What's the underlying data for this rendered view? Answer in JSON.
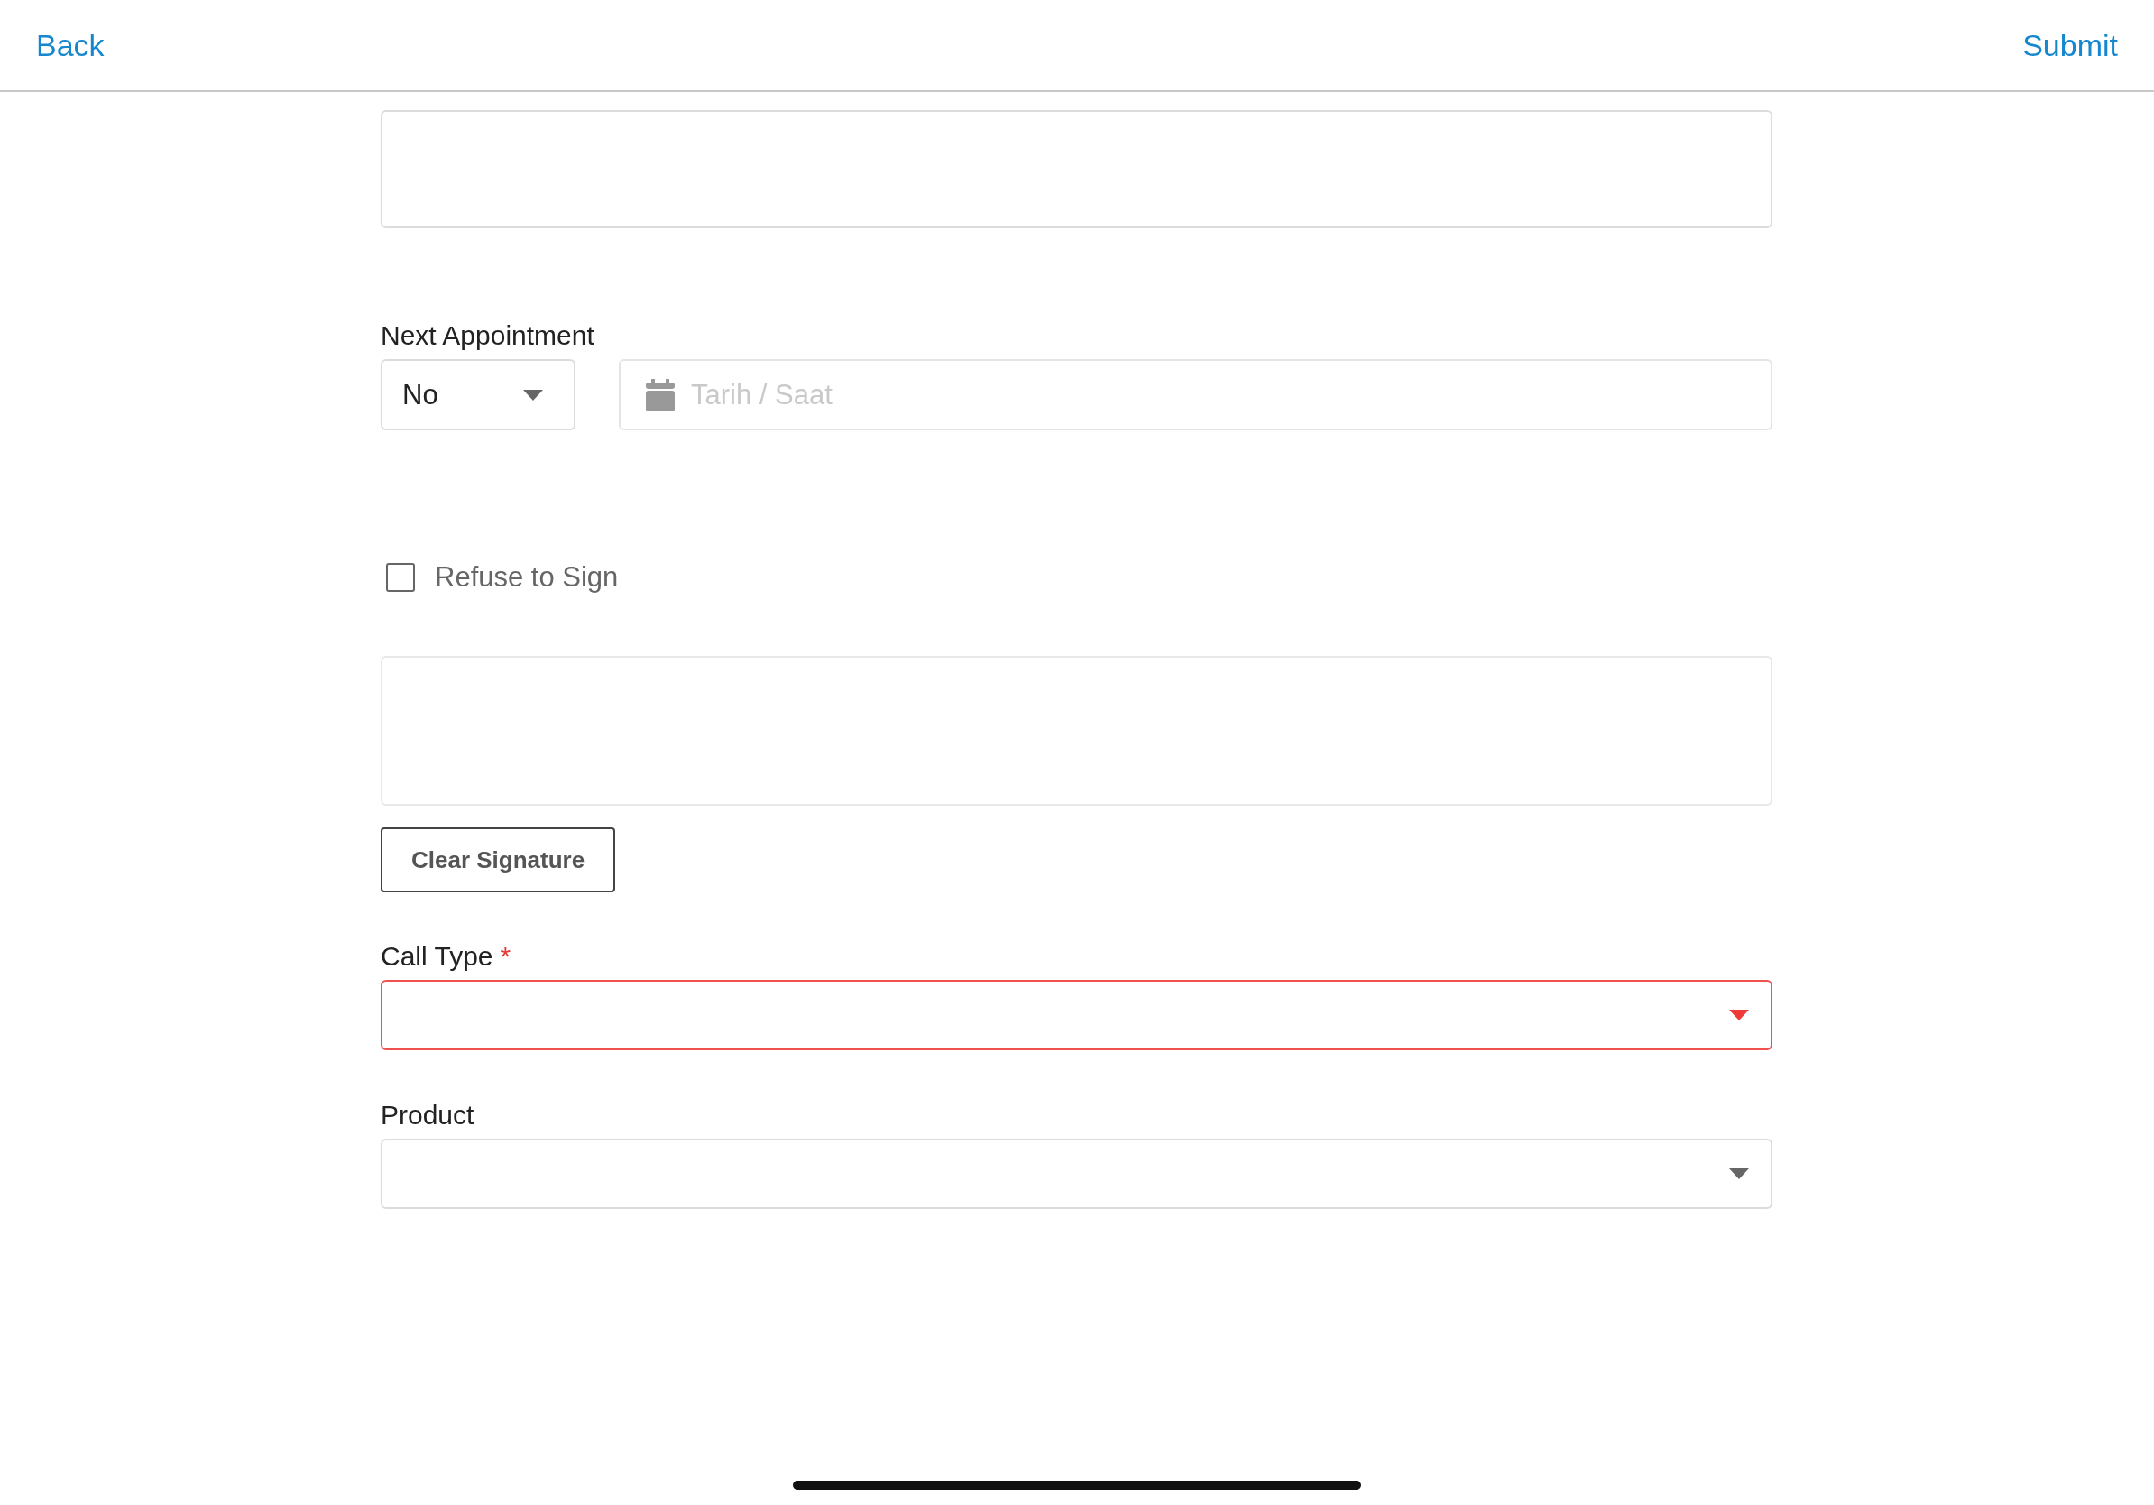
{
  "header": {
    "back": "Back",
    "submit": "Submit"
  },
  "next_appointment": {
    "label": "Next Appointment",
    "choice": "No",
    "date_placeholder": "Tarih / Saat"
  },
  "refuse_to_sign": {
    "label": "Refuse to Sign",
    "checked": false
  },
  "clear_signature": "Clear Signature",
  "fields": [
    {
      "label": "Call Type",
      "required_mark": "*",
      "invalid": true
    },
    {
      "label": "Product",
      "invalid": false
    }
  ]
}
